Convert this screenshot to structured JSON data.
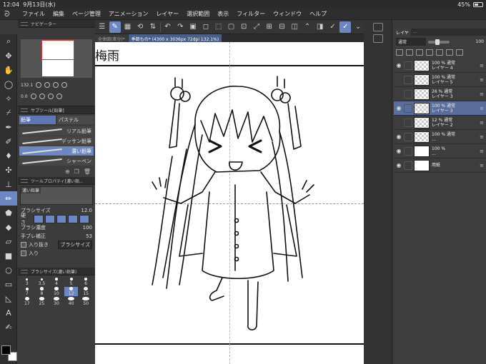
{
  "status": {
    "time": "12:04",
    "date": "9月13日(水)",
    "battery": "45%",
    "battery_level": 0.45
  },
  "menu": [
    "ファイル",
    "編集",
    "ページ管理",
    "アニメーション",
    "レイヤー",
    "選択範囲",
    "表示",
    "フィルター",
    "ウィンドウ",
    "ヘルプ"
  ],
  "navigator": {
    "title": "ナビゲーター",
    "zoom": "132.1",
    "angle": "0.0"
  },
  "subtool": {
    "title": "サブツール[鉛筆]",
    "tabs": [
      "鉛筆",
      "パステル"
    ],
    "items": [
      "リアル鉛筆",
      "デッサン鉛筆",
      "濃い鉛筆",
      "シャーペン"
    ]
  },
  "tool_property": {
    "title": "ツールプロパティ[濃い鉛...",
    "preview_label": "濃い鉛筆",
    "brush_size_label": "ブラシサイズ",
    "brush_size": "12.0",
    "hardness_label": "硬さ",
    "density_label": "ブラシ濃度",
    "density": "100",
    "stabilization_label": "手ブレ補正",
    "stabilization": "53",
    "taper_label": "入り抜き",
    "taper_select": "ブラシサイズ",
    "in_label": "入り"
  },
  "brush_size_panel": {
    "title": "ブラシサイズ(濃い鉛筆)",
    "sizes": [
      "3",
      "3.5",
      "4",
      "5",
      "6",
      "7",
      "8",
      "10",
      "12",
      "15",
      "17",
      "25",
      "30",
      "40",
      "50"
    ]
  },
  "canvas": {
    "tabs": [
      "全体図(差分)*",
      "季節もの* (4300 x 3036px 72dpi 132.1%)"
    ],
    "title_text": "梅雨"
  },
  "layers": {
    "tabs": [
      "レイヤ",
      "..."
    ],
    "blend_mode": "通常",
    "opacity": "100",
    "items": [
      {
        "visible": true,
        "info": [
          "100 % 通常",
          "レイヤー 4"
        ],
        "selected": false
      },
      {
        "visible": false,
        "info": [
          "100 % 通常",
          "レイヤー 5"
        ],
        "selected": false
      },
      {
        "visible": false,
        "info": [
          "26 % 通常",
          "レイヤー 3"
        ],
        "selected": false
      },
      {
        "visible": true,
        "info": [
          "100 % 通常",
          "レイヤー 3"
        ],
        "selected": true
      },
      {
        "visible": false,
        "info": [
          "12 % 通常",
          "レイヤー 2"
        ],
        "selected": false
      },
      {
        "visible": true,
        "info": [
          "100 % 通常",
          "..."
        ],
        "selected": false
      },
      {
        "visible": true,
        "info": [
          "100 %",
          "..."
        ],
        "selected": false
      },
      {
        "visible": true,
        "info": [
          "用紙"
        ],
        "selected": false
      }
    ]
  }
}
